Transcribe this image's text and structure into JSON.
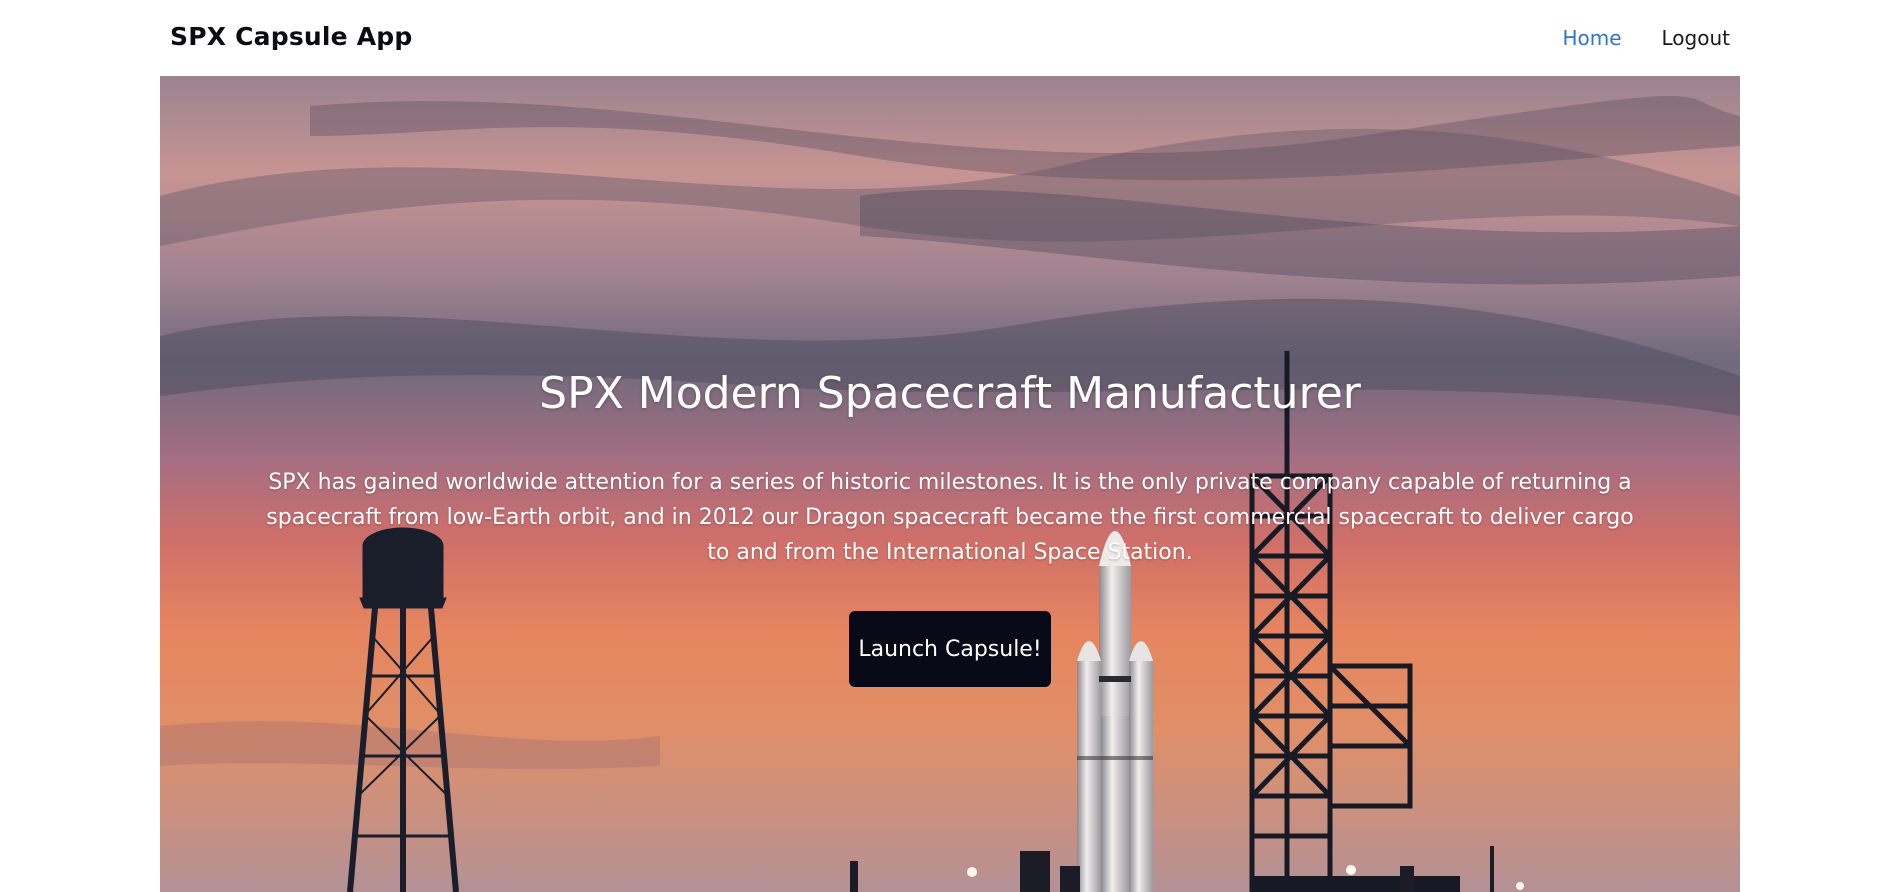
{
  "nav": {
    "brand": "SPX Capsule App",
    "links": [
      {
        "label": "Home",
        "active": true
      },
      {
        "label": "Logout",
        "active": false
      }
    ],
    "active_color": "#2f74c9"
  },
  "hero": {
    "title": "SPX Modern Spacecraft Manufacturer",
    "description": "SPX has gained worldwide attention for a series of historic milestones. It is the only private company capable of returning a spacecraft from low-Earth orbit, and in 2012 our Dragon spacecraft became the first commercial spacecraft to deliver cargo to and from the International Space Station.",
    "button_label": "Launch Capsule!",
    "button_color": "#080a17",
    "background_scene": "rocket-launch-pad-at-sunset"
  }
}
